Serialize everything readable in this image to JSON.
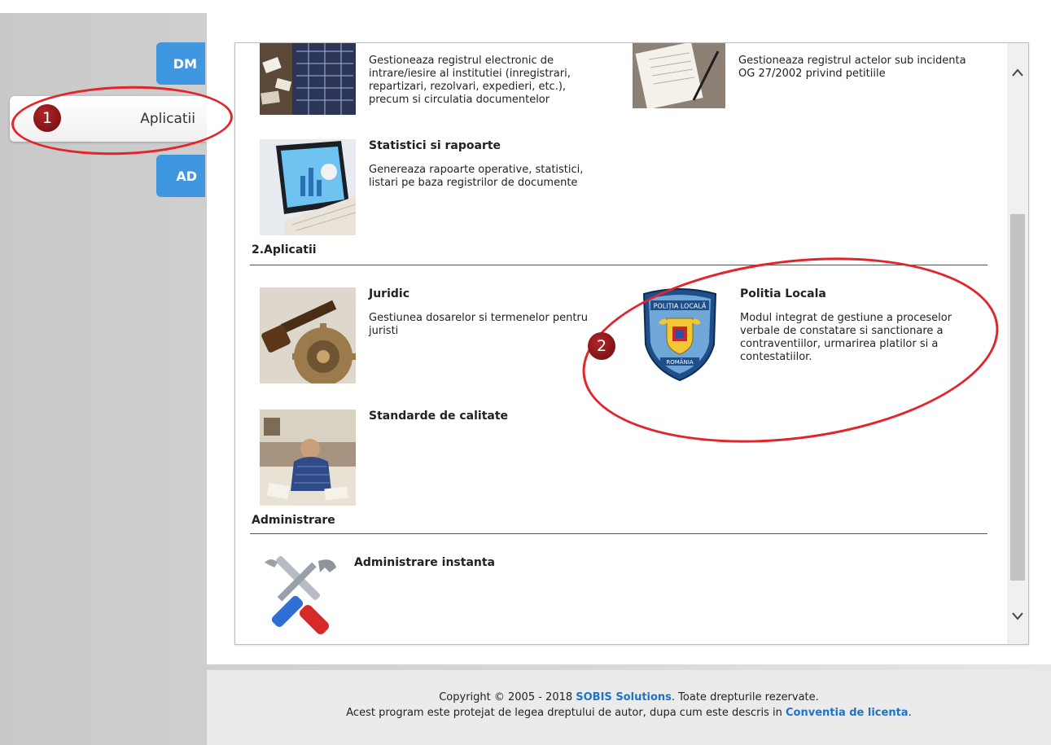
{
  "sidebar": {
    "tab_dm": "DM",
    "active_tab": "Aplicatii",
    "tab_ad": "AD"
  },
  "apps": {
    "registratura": {
      "description": "Gestioneaza registrul electronic de intrare/iesire al institutiei (inregistrari, repartizari, rezolvari, expedieri, etc.), precum si circulatia documentelor"
    },
    "petitii": {
      "description": "Gestioneaza registrul actelor sub incidenta OG 27/2002 privind petitiile"
    },
    "statistici": {
      "title": "Statistici si rapoarte",
      "description": "Genereaza rapoarte operative, statistici, listari pe baza registrilor de documente"
    },
    "juridic": {
      "title": "Juridic",
      "description": "Gestiunea dosarelor si termenelor pentru juristi"
    },
    "politia_locala": {
      "title": "Politia Locala",
      "description": "Modul integrat de gestiune a proceselor verbale de constatare si sanctionare a contraventiilor, urmarirea platilor si a contestatiilor.",
      "logo_text_top": "POLIȚIA LOCALĂ",
      "logo_text_bottom": "ROMÂNIA"
    },
    "standarde": {
      "title": "Standarde de calitate"
    },
    "administrare_instanta": {
      "title": "Administrare instanta"
    }
  },
  "sections": {
    "aplicatii": "2.Aplicatii",
    "administrare": "Administrare"
  },
  "annotations": {
    "badge_1": "1",
    "badge_2": "2"
  },
  "footer": {
    "line1_prefix": "Copyright © 2005 - 2018 ",
    "company_link": "SOBIS Solutions",
    "line1_suffix": ". Toate drepturile rezervate.",
    "line2_prefix": "Acest program este protejat de legea dreptului de autor, dupa cum este descris in ",
    "license_link": "Conventia de licenta",
    "line2_suffix": "."
  },
  "colors": {
    "tab_blue": "#3f97e0",
    "link_blue": "#1e74c4",
    "annotation_red": "#e0252b",
    "badge_red": "#8b1417"
  },
  "icons": {
    "scroll_up": "chevron-up-icon",
    "scroll_down": "chevron-down-icon",
    "tools": "wrench-screwdriver-icon"
  }
}
